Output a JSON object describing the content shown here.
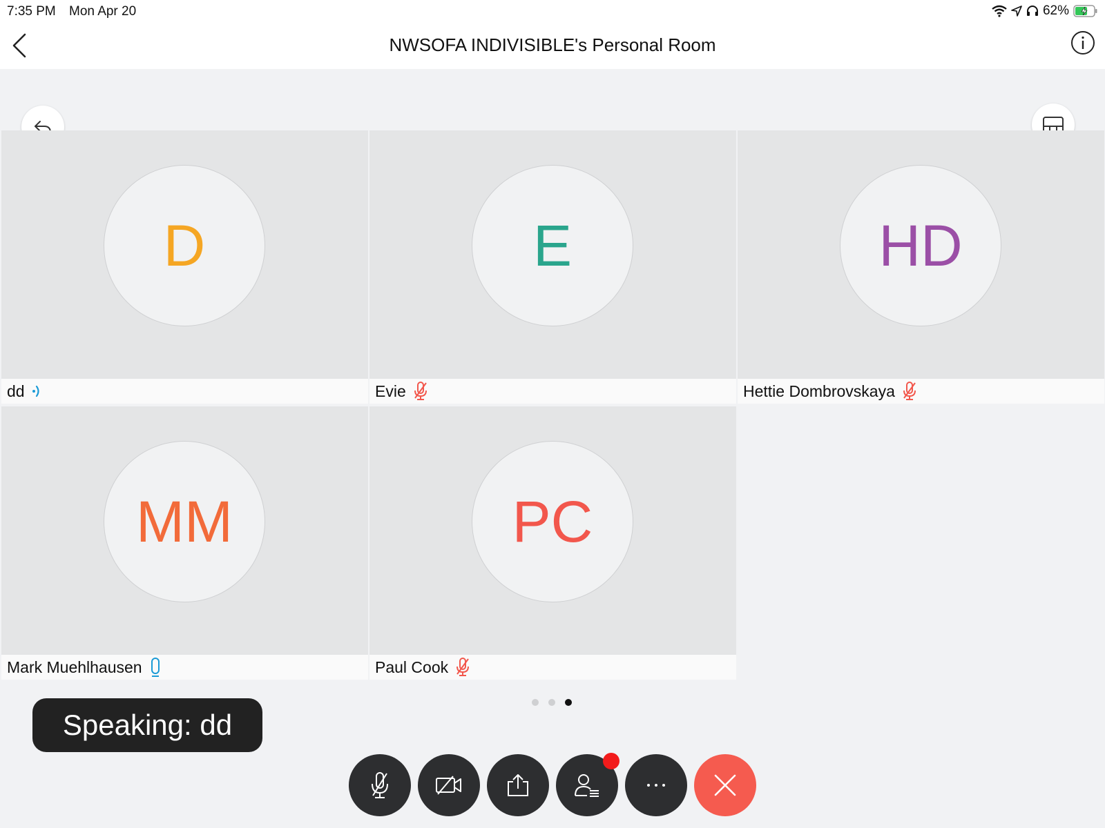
{
  "status_bar": {
    "time": "7:35 PM",
    "date": "Mon Apr 20",
    "battery_percent": "62%",
    "icons": [
      "wifi-icon",
      "location-icon",
      "headphones-icon",
      "battery-charging-icon"
    ]
  },
  "header": {
    "title": "NWSOFA INDIVISIBLE's Personal Room",
    "back_icon": "chevron-left-icon",
    "info_icon": "info-icon"
  },
  "view_controls": {
    "return_icon": "return-arrow-icon",
    "layout_icon": "layout-toggle-icon"
  },
  "participants": [
    {
      "initials": "D",
      "name": "dd",
      "initial_color": "#f5a623",
      "audio_state": "speaking"
    },
    {
      "initials": "E",
      "name": "Evie",
      "initial_color": "#2aa58c",
      "audio_state": "muted"
    },
    {
      "initials": "HD",
      "name": "Hettie Dombrovskaya",
      "initial_color": "#9b4fa6",
      "audio_state": "muted"
    },
    {
      "initials": "MM",
      "name": "Mark Muehlhausen",
      "initial_color": "#f26b3a",
      "audio_state": "unmuted"
    },
    {
      "initials": "PC",
      "name": "Paul Cook",
      "initial_color": "#f2574c",
      "audio_state": "muted"
    }
  ],
  "pagination": {
    "total": 3,
    "current": 3
  },
  "speaking_indicator": "Speaking: dd",
  "controls": [
    {
      "name": "mute-button",
      "icon": "microphone-off-icon"
    },
    {
      "name": "video-button",
      "icon": "video-off-icon"
    },
    {
      "name": "share-button",
      "icon": "share-icon"
    },
    {
      "name": "participants-button",
      "icon": "participants-icon",
      "badge": true
    },
    {
      "name": "more-button",
      "icon": "more-icon"
    },
    {
      "name": "leave-button",
      "icon": "close-icon"
    }
  ],
  "colors": {
    "muted_mic": "#f2574c",
    "active_mic": "#1a9ad6",
    "end_call": "#f55b4f",
    "control_bg": "#2d2e30"
  }
}
